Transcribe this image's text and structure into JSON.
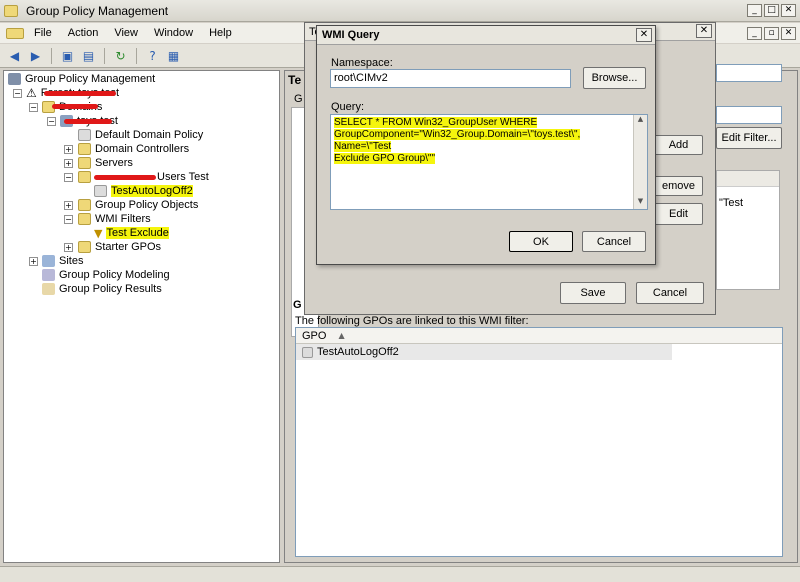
{
  "app": {
    "title": "Group Policy Management",
    "menu": [
      "File",
      "Action",
      "View",
      "Window",
      "Help"
    ]
  },
  "tree": {
    "root": "Group Policy Management",
    "forest": "Forest: toys.test",
    "domains": "Domains",
    "domain": "toys.test",
    "items": {
      "ddp": "Default Domain Policy",
      "dc": "Domain Controllers",
      "servers": "Servers",
      "users_test": "Users Test",
      "autolog": "TestAutoLogOff2",
      "gpo": "Group Policy Objects",
      "wmi": "WMI Filters",
      "test_exclude": "Test Exclude",
      "starter": "Starter GPOs",
      "sites": "Sites",
      "modeling": "Group Policy Modeling",
      "results": "Group Policy Results"
    }
  },
  "right_pane": {
    "title_fragment": "Te",
    "tab_fragment": "G",
    "edit_filter": "Edit Filter...",
    "add": "Add",
    "remove": "emove",
    "edit": "Edit",
    "value_fragment": "\"Test",
    "linked_heading": "G",
    "linked_desc": "The following GPOs are linked to this WMI filter:",
    "gpo_col": "GPO",
    "gpo_rows": [
      "TestAutoLogOff2"
    ]
  },
  "big_dialog": {
    "title_fragment": "Te",
    "save": "Save",
    "cancel": "Cancel"
  },
  "wmi_dialog": {
    "title": "WMI Query",
    "namespace_label": "Namespace:",
    "namespace_value": "root\\CIMv2",
    "browse": "Browse...",
    "query_label": "Query:",
    "query_line1": "SELECT * FROM Win32_GroupUser WHERE",
    "query_line2": "GroupComponent=\"Win32_Group.Domain=\\\"toys.test\\\", Name=\\\"Test",
    "query_line3": "Exclude GPO Group\\\"\"",
    "ok": "OK",
    "cancel": "Cancel"
  },
  "colors": {
    "highlight": "#f5f50d",
    "redact": "#e01818"
  }
}
